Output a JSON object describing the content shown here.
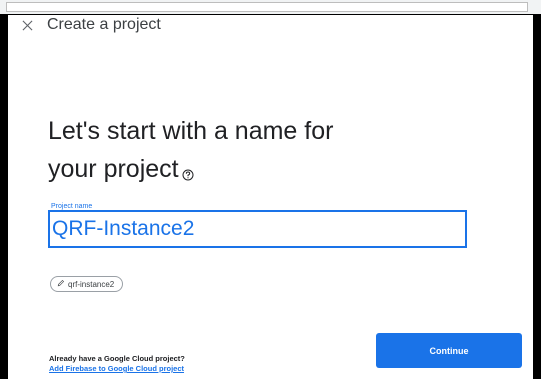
{
  "dialog": {
    "title": "Create a project",
    "heading_line1": "Let's start with a name for",
    "heading_line2": "your project"
  },
  "project_name": {
    "label": "Project name",
    "value": "QRF-Instance2"
  },
  "project_id_chip": {
    "value": "qrf-instance2"
  },
  "footer": {
    "gcp_question": "Already have a Google Cloud project?",
    "gcp_link": "Add Firebase to Google Cloud project",
    "continue_label": "Continue"
  },
  "colors": {
    "accent": "#1a73e8",
    "text": "#202124"
  },
  "icons": [
    "close-icon",
    "help-icon",
    "edit-icon"
  ]
}
